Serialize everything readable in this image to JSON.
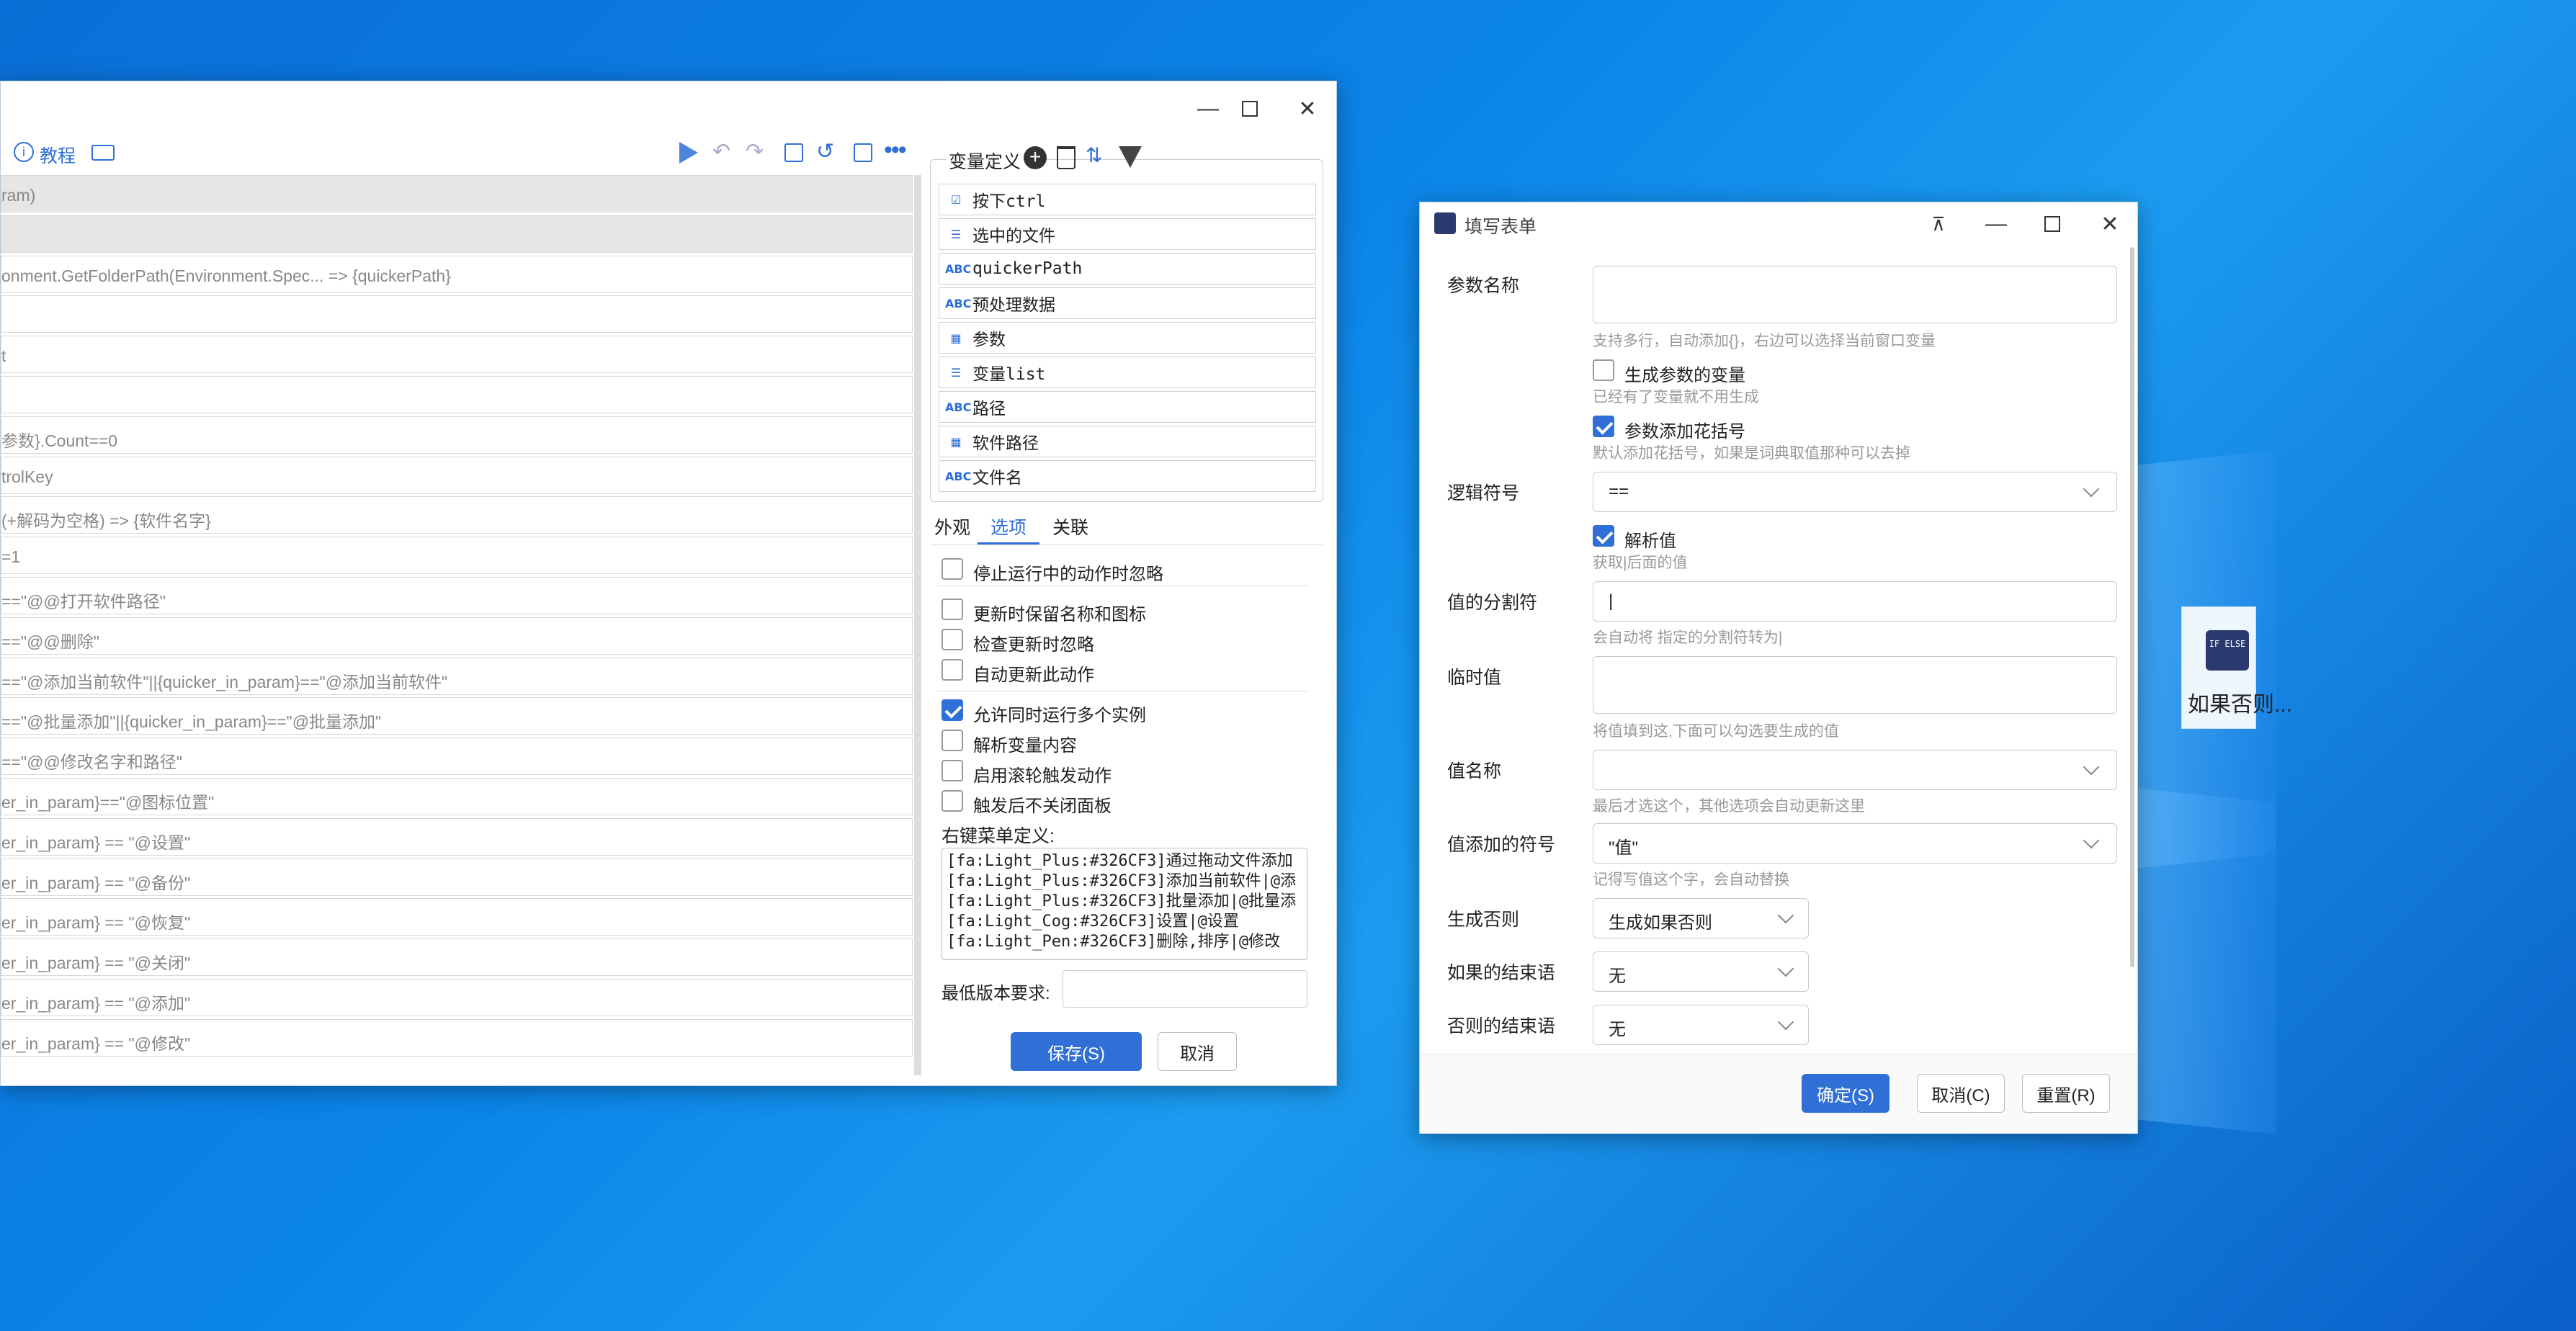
{
  "editor": {
    "toolbar": {
      "tutorial": "教程"
    },
    "code_rows": [
      "ram)",
      "",
      "onment.GetFolderPath(Environment.Spec... => {quickerPath}",
      "",
      "t",
      "",
      "参数}.Count==0",
      "trolKey",
      "(+解码为空格) => {软件名字}",
      "=1",
      "==\"@@打开软件路径\"",
      "==\"@@删除\"",
      "==\"@添加当前软件\"||{quicker_in_param}==\"@添加当前软件\"",
      "==\"@批量添加\"||{quicker_in_param}==\"@批量添加\"",
      "==\"@@修改名字和路径\"",
      "er_in_param}==\"@图标位置\"",
      "er_in_param} == \"@设置\"",
      "er_in_param} == \"@备份\"",
      "er_in_param} == \"@恢复\"",
      "er_in_param} == \"@关闭\"",
      "er_in_param} == \"@添加\"",
      "er_in_param} == \"@修改\""
    ],
    "vars": {
      "title": "变量定义",
      "items": [
        {
          "icon": "☑",
          "label": "按下ctrl"
        },
        {
          "icon": "☰",
          "label": "选中的文件"
        },
        {
          "icon": "ABC",
          "label": "quickerPath"
        },
        {
          "icon": "ABC",
          "label": "预处理数据"
        },
        {
          "icon": "▦",
          "label": "参数"
        },
        {
          "icon": "☰",
          "label": "变量list"
        },
        {
          "icon": "ABC",
          "label": "路径"
        },
        {
          "icon": "▦",
          "label": "软件路径"
        },
        {
          "icon": "ABC",
          "label": "文件名"
        }
      ]
    },
    "tabs": [
      "外观",
      "选项",
      "关联"
    ],
    "options": [
      {
        "label": "停止运行中的动作时忽略",
        "checked": false
      },
      {
        "label": "更新时保留名称和图标",
        "checked": false
      },
      {
        "label": "检查更新时忽略",
        "checked": false
      },
      {
        "label": "自动更新此动作",
        "checked": false
      },
      {
        "label": "允许同时运行多个实例",
        "checked": true
      },
      {
        "label": "解析变量内容",
        "checked": false
      },
      {
        "label": "启用滚轮触发动作",
        "checked": false
      },
      {
        "label": "触发后不关闭面板",
        "checked": false
      }
    ],
    "context_menu_label": "右键菜单定义:",
    "context_menu_lines": [
      "[fa:Light_Plus:#326CF3]通过拖动文件添加",
      "[fa:Light_Plus:#326CF3]添加当前软件|@添",
      "[fa:Light_Plus:#326CF3]批量添加|@批量添",
      "[fa:Light_Cog:#326CF3]设置|@设置",
      "[fa:Light_Pen:#326CF3]删除,排序|@修改"
    ],
    "min_version_label": "最低版本要求:",
    "save": "保存(S)",
    "cancel": "取消"
  },
  "form": {
    "title": "填写表单",
    "param_name": {
      "label": "参数名称",
      "hint": "支持多行，自动添加{}，右边可以选择当前窗口变量"
    },
    "gen_var": {
      "label": "生成参数的变量",
      "hint": "已经有了变量就不用生成"
    },
    "add_braces": {
      "label": "参数添加花括号",
      "hint": "默认添加花括号，如果是词典取值那种可以去掉"
    },
    "logic": {
      "label": "逻辑符号",
      "value": "=="
    },
    "parse": {
      "label": "解析值",
      "hint": "获取|后面的值"
    },
    "separator": {
      "label": "值的分割符",
      "value": "|",
      "hint": "会自动将 指定的分割符转为|"
    },
    "temp": {
      "label": "临时值",
      "hint": "将值填到这,下面可以勾选要生成的值"
    },
    "value_name": {
      "label": "值名称",
      "hint": "最后才选这个，其他选项会自动更新这里"
    },
    "value_symbol": {
      "label": "值添加的符号",
      "value": "\"值\"",
      "hint": "记得写值这个字，会自动替换"
    },
    "gen_else": {
      "label": "生成否则",
      "value": "生成如果否则"
    },
    "if_end": {
      "label": "如果的结束语",
      "value": "无"
    },
    "else_end": {
      "label": "否则的结束语",
      "value": "无"
    },
    "ok": "确定(S)",
    "cancel": "取消(C)",
    "reset": "重置(R)"
  },
  "desktop_icon": {
    "label": "如果否则...",
    "badge": "IF ELSE"
  }
}
